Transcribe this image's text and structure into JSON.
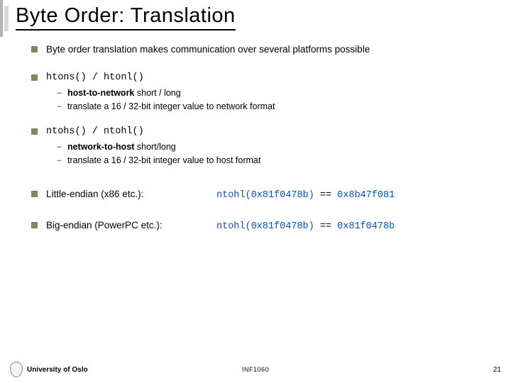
{
  "title": "Byte Order: Translation",
  "bullets": {
    "intro": "Byte order translation makes communication over several platforms possible",
    "htons_code": "htons() / htonl()",
    "htons_sub1_a": "host-to-network",
    "htons_sub1_b": " short / long",
    "htons_sub2": "translate a 16 / 32-bit integer value to network format",
    "ntohs_code": "ntohs() / ntohl()",
    "ntohs_sub1_a": "network-to-host",
    "ntohs_sub1_b": " short/long",
    "ntohs_sub2": "translate a 16 / 32-bit integer value to host format",
    "little_label": "Little-endian (x86 etc.):",
    "little_call": "ntohl(0x81f0478b)",
    "little_eq": " == ",
    "little_res": "0x8b47f081",
    "big_label": "Big-endian (PowerPC etc.):",
    "big_call": "ntohl(0x81f0478b)",
    "big_eq": " == ",
    "big_res": "0x81f0478b"
  },
  "footer": {
    "uni": "University of Oslo",
    "course": "INF1060",
    "page": "21"
  }
}
